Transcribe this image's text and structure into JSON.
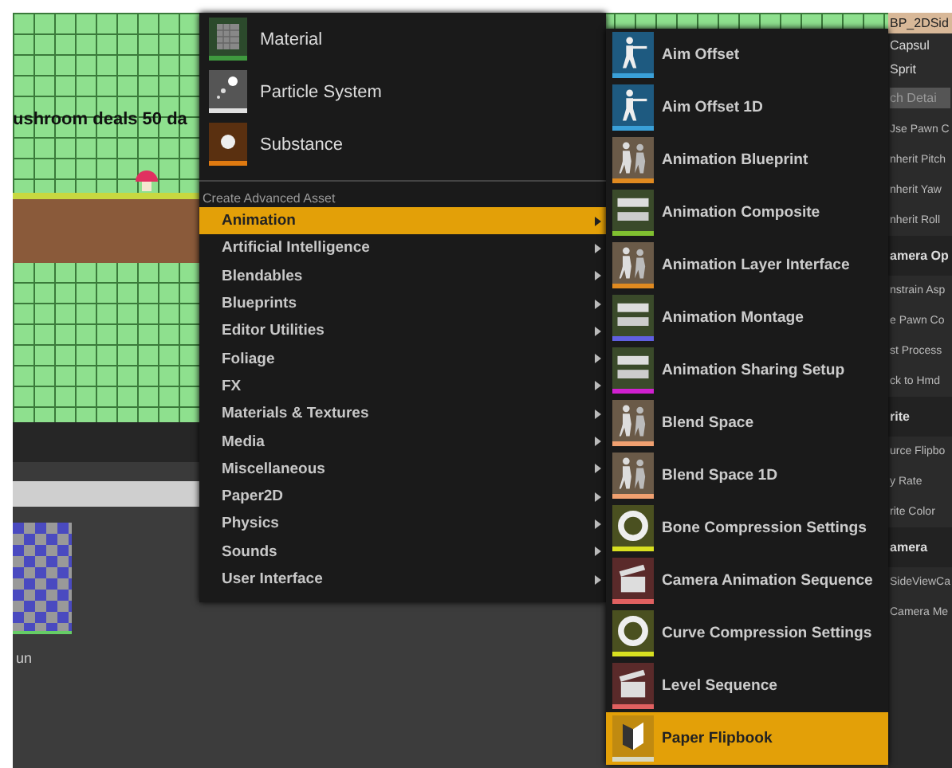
{
  "viewport": {
    "overlay_text": "ushroom deals 50 da"
  },
  "content_browser": {
    "asset_label": "un"
  },
  "details_panel": {
    "tab_title": "BP_2DSid",
    "components": [
      "Capsul",
      "Sprit"
    ],
    "search_placeholder": "ch Detai",
    "rows": [
      {
        "kind": "row",
        "label": "Jse Pawn C"
      },
      {
        "kind": "row",
        "label": "nherit Pitch"
      },
      {
        "kind": "row",
        "label": "nherit Yaw"
      },
      {
        "kind": "row",
        "label": "nherit Roll"
      },
      {
        "kind": "section",
        "label": "amera Op"
      },
      {
        "kind": "row",
        "label": "nstrain Asp"
      },
      {
        "kind": "row",
        "label": "e Pawn Co"
      },
      {
        "kind": "row",
        "label": "st Process"
      },
      {
        "kind": "row",
        "label": "ck to Hmd"
      },
      {
        "kind": "section",
        "label": "rite"
      },
      {
        "kind": "row",
        "label": "urce Flipbo"
      },
      {
        "kind": "row",
        "label": "y Rate"
      },
      {
        "kind": "row",
        "label": "rite Color"
      },
      {
        "kind": "section",
        "label": "amera"
      },
      {
        "kind": "row",
        "label": "SideViewCa"
      },
      {
        "kind": "row",
        "label": "Camera Me"
      }
    ]
  },
  "context_menu": {
    "common_assets": [
      {
        "label": "Material",
        "kind": "material",
        "color": "#3f9a3f"
      },
      {
        "label": "Particle System",
        "kind": "particles",
        "color": "#e0e0e0"
      },
      {
        "label": "Substance",
        "kind": "substance",
        "color": "#e07a10"
      }
    ],
    "section_header": "Create Advanced Asset",
    "categories": [
      {
        "label": "Animation",
        "selected": true
      },
      {
        "label": "Artificial Intelligence",
        "selected": false
      },
      {
        "label": "Blendables",
        "selected": false
      },
      {
        "label": "Blueprints",
        "selected": false
      },
      {
        "label": "Editor Utilities",
        "selected": false
      },
      {
        "label": "Foliage",
        "selected": false
      },
      {
        "label": "FX",
        "selected": false
      },
      {
        "label": "Materials & Textures",
        "selected": false
      },
      {
        "label": "Media",
        "selected": false
      },
      {
        "label": "Miscellaneous",
        "selected": false
      },
      {
        "label": "Paper2D",
        "selected": false
      },
      {
        "label": "Physics",
        "selected": false
      },
      {
        "label": "Sounds",
        "selected": false
      },
      {
        "label": "User Interface",
        "selected": false
      }
    ]
  },
  "submenu": {
    "items": [
      {
        "label": "Aim Offset",
        "kind": "figure",
        "color": "#3aa0d8",
        "selected": false
      },
      {
        "label": "Aim Offset 1D",
        "kind": "figure",
        "color": "#3aa0d8",
        "selected": false
      },
      {
        "label": "Animation Blueprint",
        "kind": "walkers",
        "color": "#e08a20",
        "selected": false
      },
      {
        "label": "Animation Composite",
        "kind": "strips",
        "color": "#80c030",
        "selected": false
      },
      {
        "label": "Animation Layer Interface",
        "kind": "walkers",
        "color": "#e08a20",
        "selected": false
      },
      {
        "label": "Animation Montage",
        "kind": "strips",
        "color": "#6060e0",
        "selected": false
      },
      {
        "label": "Animation Sharing Setup",
        "kind": "strips",
        "color": "#d020d0",
        "selected": false
      },
      {
        "label": "Blend Space",
        "kind": "walkers",
        "color": "#f0a070",
        "selected": false
      },
      {
        "label": "Blend Space 1D",
        "kind": "walkers",
        "color": "#f0a070",
        "selected": false
      },
      {
        "label": "Bone Compression Settings",
        "kind": "ring",
        "color": "#d8e020",
        "selected": false
      },
      {
        "label": "Camera Animation Sequence",
        "kind": "clapper",
        "color": "#e06060",
        "selected": false
      },
      {
        "label": "Curve Compression Settings",
        "kind": "ring",
        "color": "#d8e020",
        "selected": false
      },
      {
        "label": "Level Sequence",
        "kind": "clapper",
        "color": "#e06060",
        "selected": false
      },
      {
        "label": "Paper Flipbook",
        "kind": "book",
        "color": "#d8d8c0",
        "selected": true
      }
    ]
  }
}
